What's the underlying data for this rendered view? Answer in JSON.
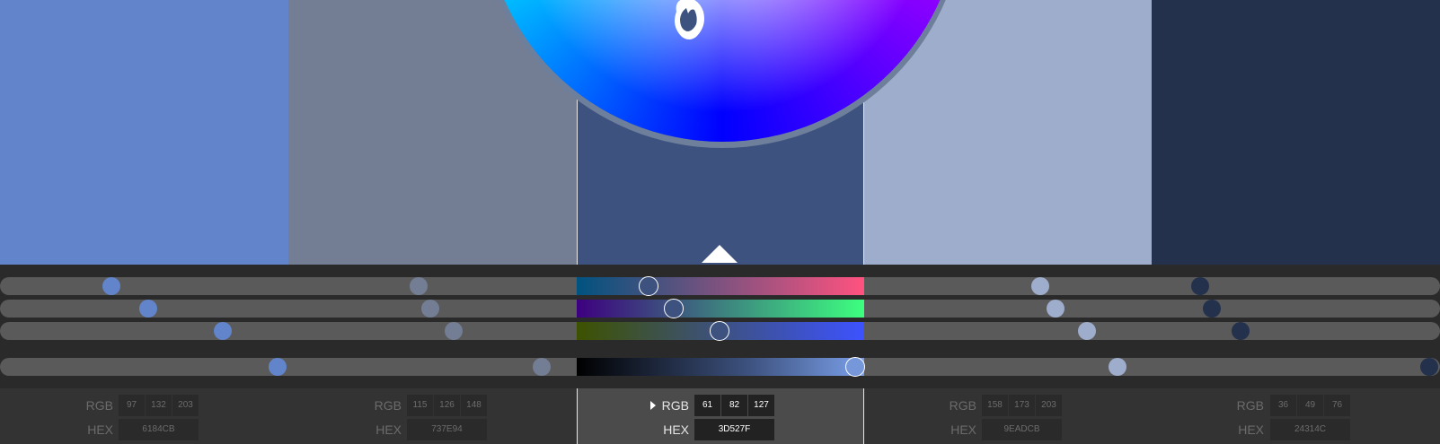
{
  "labels": {
    "rgb": "RGB",
    "hex": "HEX"
  },
  "colors": [
    {
      "hex": "6184CB",
      "r": "97",
      "g": "132",
      "b": "203",
      "swatch": "#6184CB",
      "active": false
    },
    {
      "hex": "737E94",
      "r": "115",
      "g": "126",
      "b": "148",
      "swatch": "#737E94",
      "active": false
    },
    {
      "hex": "3D527F",
      "r": "61",
      "g": "82",
      "b": "127",
      "swatch": "#3D527F",
      "active": true
    },
    {
      "hex": "9EADCB",
      "r": "158",
      "g": "173",
      "b": "203",
      "swatch": "#9EADCB",
      "active": false
    },
    {
      "hex": "24314C",
      "r": "36",
      "g": "49",
      "b": "76",
      "swatch": "#24314C",
      "active": false
    }
  ],
  "active_channel_levels": {
    "red": 0.251,
    "green": 0.338,
    "blue": 0.498,
    "brightness": 0.97
  }
}
